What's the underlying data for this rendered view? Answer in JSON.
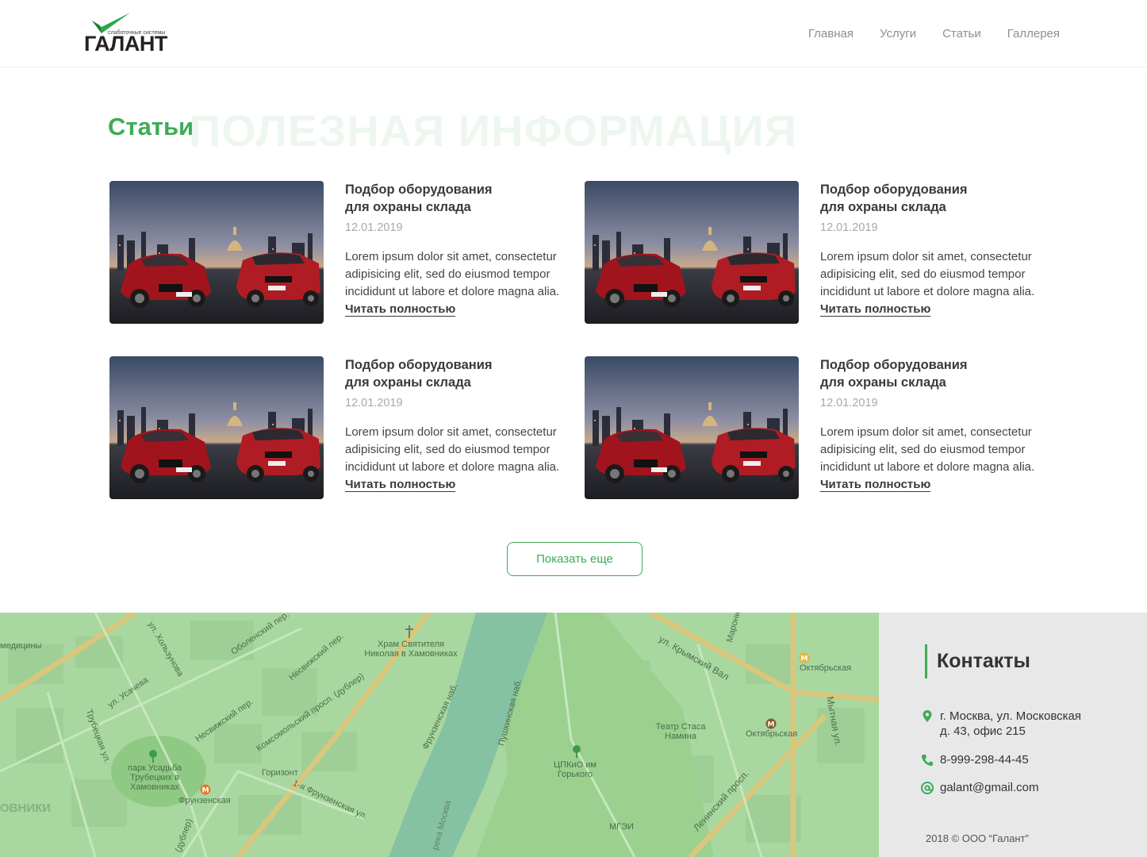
{
  "header": {
    "logo_name": "ГАЛАНТ",
    "logo_sub": "слаботочные системы",
    "nav": [
      "Главная",
      "Услуги",
      "Статьи",
      "Галлерея"
    ]
  },
  "section": {
    "title": "Статьи",
    "bg_title": "ПОЛЕЗНАЯ ИНФОРМАЦИЯ"
  },
  "articles": [
    {
      "title": "Подбор оборудования для охраны склада",
      "date": "12.01.2019",
      "text": "Lorem ipsum dolor sit amet, consectetur adipisicing elit, sed do eiusmod tempor incididunt ut labore et dolore magna alia. ",
      "link": "Читать полностью",
      "plate_left": "LS5 993",
      "plate_right": "LS5 SE3"
    },
    {
      "title": "Подбор оборудования для охраны склада",
      "date": "12.01.2019",
      "text": "Lorem ipsum dolor sit amet, consectetur adipisicing elit, sed do eiusmod tempor incididunt ut labore et dolore magna alia. ",
      "link": "Читать полностью",
      "plate_left": "LS5 993",
      "plate_right": "LS5 SE3"
    },
    {
      "title": "Подбор оборудования для охраны склада",
      "date": "12.01.2019",
      "text": "Lorem ipsum dolor sit amet, consectetur adipisicing elit, sed do eiusmod tempor incididunt ut labore et dolore magna alia. ",
      "link": "Читать полностью",
      "plate_left": "LS5 993",
      "plate_right": "LS5 SE3"
    },
    {
      "title": "Подбор оборудования для охраны склада",
      "date": "12.01.2019",
      "text": "Lorem ipsum dolor sit amet, consectetur adipisicing elit, sed do eiusmod tempor incididunt ut labore et dolore magna alia. ",
      "link": "Читать полностью",
      "plate_left": "LS5 993",
      "plate_right": "LS5 SE3"
    }
  ],
  "more_button": "Показать еще",
  "map": {
    "labels": [
      "медицины",
      "Оболенский пер.",
      "ул. Хользунова",
      "Несвижский пер.",
      "Храм Святителя Николая в Хамовниках",
      "ул. Усачева",
      "Несвижский пер.",
      "Комсомольский просп. (дублер)",
      "Трубецкая ул.",
      "парк Усадьба Трубецких в Хамовниках",
      "Горизонт",
      "Фрунзенская",
      "1-я Фрунзенская ул.",
      "Фрунзенская наб.",
      "Пушкинская наб.",
      "река Москва",
      "ЦПКиО им Горького",
      "МГЭИ",
      "ул. Крымский Вал",
      "Октябрьская",
      "Театр Стаса Намина",
      "Октябрьская",
      "Мытная ул.",
      "Ленинский просп.",
      "Марони",
      "ОВНИКИ",
      "(дублер)"
    ]
  },
  "contacts": {
    "title": "Контакты",
    "address_line1": "г. Москва, ул. Московская",
    "address_line2": "д. 43, офис 215",
    "phone": "8-999-298-44-45",
    "email": "galant@gmail.com",
    "copyright": "2018 © ООО “Галант”"
  },
  "colors": {
    "accent": "#3dab57",
    "map_green": "#a9d7a0",
    "river": "#85c2a4",
    "contacts_bg": "#e8e8e8"
  }
}
